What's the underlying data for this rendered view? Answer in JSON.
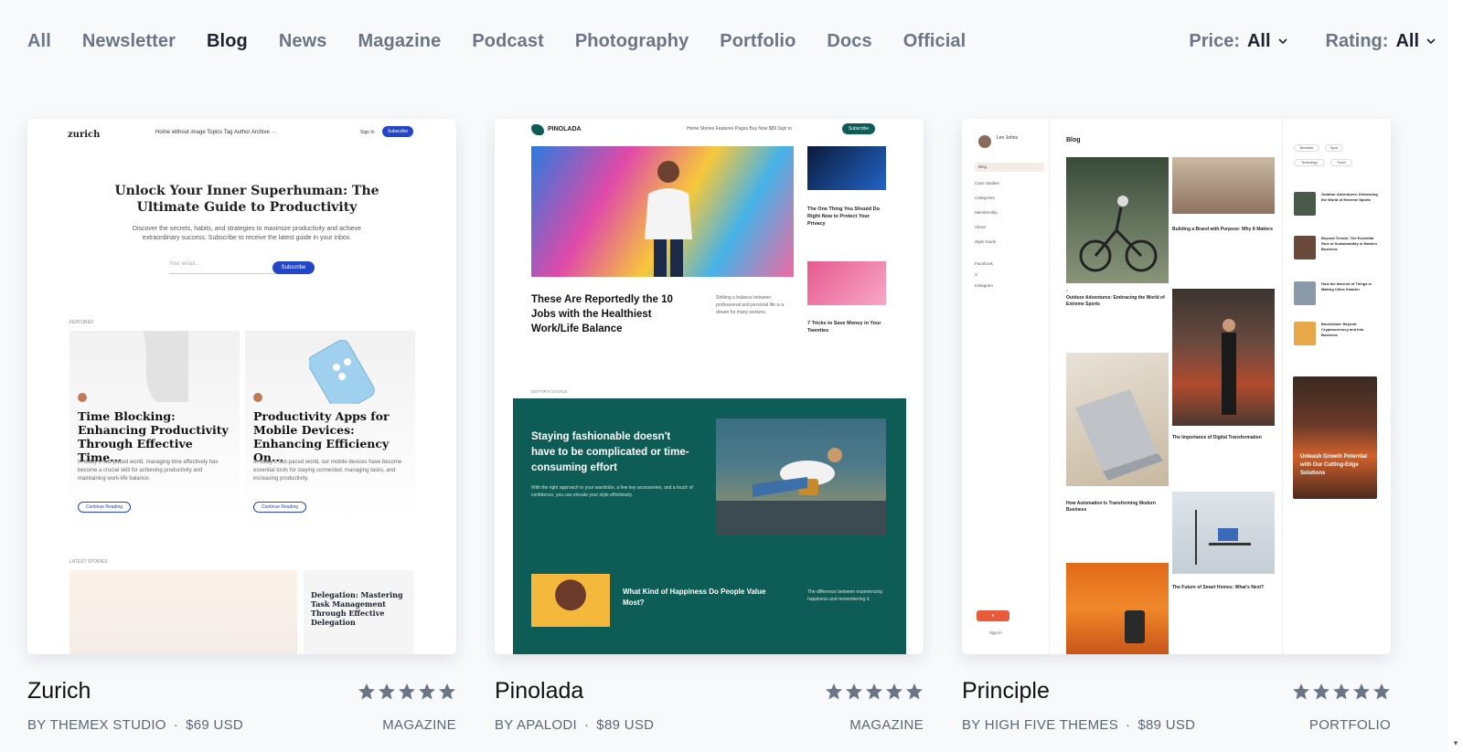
{
  "categories": [
    {
      "label": "All",
      "active": false
    },
    {
      "label": "Newsletter",
      "active": false
    },
    {
      "label": "Blog",
      "active": true
    },
    {
      "label": "News",
      "active": false
    },
    {
      "label": "Magazine",
      "active": false
    },
    {
      "label": "Podcast",
      "active": false
    },
    {
      "label": "Photography",
      "active": false
    },
    {
      "label": "Portfolio",
      "active": false
    },
    {
      "label": "Docs",
      "active": false
    },
    {
      "label": "Official",
      "active": false
    }
  ],
  "filters": {
    "price": {
      "label": "Price:",
      "value": "All"
    },
    "rating": {
      "label": "Rating:",
      "value": "All"
    }
  },
  "themes": [
    {
      "name": "Zurich",
      "author": "BY THEMEX STUDIO",
      "price": "$69 USD",
      "category": "MAGAZINE",
      "rating": 5,
      "preview": {
        "logo": "zurich",
        "nav": "Home without image   Topics   Tag   Author   Archive   ···",
        "nav_btn": "Subscribe",
        "signin": "Sign In",
        "hero_title": "Unlock Your Inner Superhuman: The Ultimate Guide to Productivity",
        "hero_sub": "Discover the secrets, habits, and strategies to maximize productivity and achieve extraordinary success. Subscribe to receive the latest guide in your inbox.",
        "email_placeholder": "Your email...",
        "subscribe": "Subscribe",
        "featured_label": "FEATURED",
        "feat1_title": "Time Blocking: Enhancing Productivity Through Effective Time...",
        "feat1_text": "In today's fast-paced world, managing time effectively has become a crucial skill for achieving productivity and maintaining work-life balance.",
        "feat1_btn": "Continue Reading",
        "feat2_title": "Productivity Apps for Mobile Devices: Enhancing Efficiency On...",
        "feat2_text": "In today's fast-paced world, our mobile devices have become essential tools for staying connected, managing tasks, and increasing productivity.",
        "feat2_btn": "Continue Reading",
        "latest_label": "LATEST STORIES",
        "small_title": "Delegation: Mastering Task Management Through Effective Delegation"
      }
    },
    {
      "name": "Pinolada",
      "author": "BY APALODI",
      "price": "$89 USD",
      "category": "MAGAZINE",
      "rating": 5,
      "preview": {
        "logo": "PINOLADA",
        "nav": "Home   Stories   Features   Pages   Buy Now $89   Sign in",
        "nav_btn": "Subscribe",
        "main_title": "These Are Reportedly the 10 Jobs with the Healthiest Work/Life Balance",
        "main_sub": "Striking a balance between professional and personal life is a dream for many workers.",
        "side1": "The One Thing You Should Do Right Now to Protect Your Privacy",
        "side2": "7 Tricks to Save Money in Your Twenties",
        "editors_label": "EDITOR'S CHOICE",
        "green_title": "Staying fashionable doesn't have to be complicated or time-consuming effort",
        "green_sub": "With the right approach to your wardrobe, a few key accessories, and a touch of confidence, you can elevate your style effortlessly.",
        "green_title2": "What Kind of Happiness Do People Value Most?",
        "green_sub2": "The difference between experiencing happiness and remembering it."
      }
    },
    {
      "name": "Principle",
      "author": "BY HIGH FIVE THEMES",
      "price": "$89 USD",
      "category": "PORTFOLIO",
      "rating": 5,
      "preview": {
        "user": "Leo Johns",
        "menu": [
          "Blog",
          "Case Studies",
          "Categories",
          "Membership",
          "About",
          "Style Guide"
        ],
        "social": [
          "Facebook",
          "X",
          "Instagram"
        ],
        "signin": "Sign in",
        "blog": "Blog",
        "p1": "Outdoor Adventures: Embracing the World of Extreme Sports",
        "p2": "Building a Brand with Purpose: Why It Matters",
        "p3": "How Automation Is Transforming Modern Business",
        "p4": "The Importance of Digital Transformation",
        "p5": "The Future of Smart Homes: What's Next?",
        "right": [
          "Outdoor Adventures: Embracing the World of Extreme Sports",
          "Beyond Trends: The Essential Role of Sustainability in Modern Business",
          "How the Internet of Things is Making Cities Smarter",
          "Blockchain: Beyond Cryptocurrency and Into Business"
        ],
        "tags": [
          "Business",
          "Sport",
          "Technology",
          "Travel"
        ],
        "ad": "Unleash Growth Potential with Our Cutting-Edge Solutions"
      }
    }
  ],
  "colors": {
    "active_text": "#1c2230",
    "inactive_text": "#6b7585",
    "star": "#6b7585",
    "zurich_blue": "#2346c8",
    "pinolada_green": "#0d5c56",
    "principle_red": "#e85a3a"
  }
}
